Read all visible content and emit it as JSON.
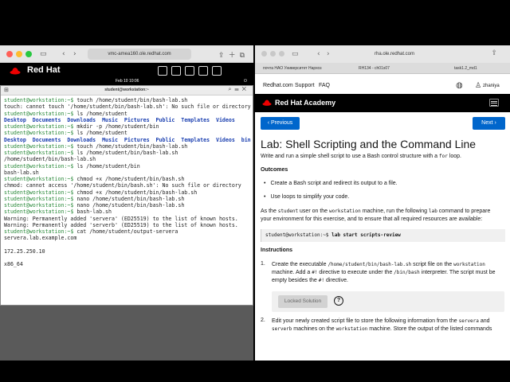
{
  "left_window": {
    "url": "vmc-amea160.ole.redhat.com",
    "tool_icons": {
      "sidebar": "sidebar-icon",
      "back": "‹",
      "forward": "›"
    },
    "brand": "Red Hat",
    "clock": "Feb 10  10:06",
    "terminal_title": "student@workstation:~",
    "terminal_lines": [
      {
        "prompt": "student@workstation:~$",
        "text": " touch /home/student/bin/bash-lab.sh"
      },
      {
        "text": "touch: cannot touch '/home/student/bin/bash-lab.sh': No such file or directory"
      },
      {
        "prompt": "student@workstation:~$",
        "text": " ls /home/student"
      },
      {
        "dirs": "Desktop  Documents  Downloads  Music  Pictures  Public  Templates  Videos"
      },
      {
        "prompt": "student@workstation:~$",
        "text": " mkdir -p /home/student/bin"
      },
      {
        "prompt": "student@workstation:~$",
        "text": " ls /home/student"
      },
      {
        "dirs": "Desktop  Documents  Downloads  Music  Pictures  Public  Templates  Videos  bin"
      },
      {
        "prompt": "student@workstation:~$",
        "text": " touch /home/student/bin/bash-lab.sh"
      },
      {
        "prompt": "student@workstation:~$",
        "text": " ls /home/student/bin/bash-lab.sh"
      },
      {
        "text": "/home/student/bin/bash-lab.sh"
      },
      {
        "prompt": "student@workstation:~$",
        "text": " ls /home/student/bin"
      },
      {
        "text": "bash-lab.sh"
      },
      {
        "prompt": "student@workstation:~$",
        "text": " chmod +x /home/student/bin/bash.sh"
      },
      {
        "text": "chmod: cannot access '/home/student/bin/bash.sh': No such file or directory"
      },
      {
        "prompt": "student@workstation:~$",
        "text": " chmod +x /home/student/bin/bash-lab.sh"
      },
      {
        "prompt": "student@workstation:~$",
        "text": " nano /home/student/bin/bash-lab.sh"
      },
      {
        "prompt": "student@workstation:~$",
        "text": " nano /home/student/bin/bash-lab.sh"
      },
      {
        "prompt": "student@workstation:~$",
        "text": " bash-lab.sh"
      },
      {
        "text": "Warning: Permanently added 'servera' (ED25519) to the list of known hosts."
      },
      {
        "text": "Warning: Permanently added 'serverb' (ED25519) to the list of known hosts."
      },
      {
        "prompt": "student@workstation:~$",
        "text": " cat /home/student/output-servera"
      },
      {
        "text": "servera.lab.example.com"
      },
      {
        "text": ""
      },
      {
        "text": "172.25.250.10"
      },
      {
        "text": ""
      },
      {
        "text": "x86_64"
      }
    ]
  },
  "right_window": {
    "url": "rha.ole.redhat.com",
    "tabs": [
      "почта НАО Университет Нархоз",
      "RH134 - ch01s07",
      "task1.2_md1"
    ],
    "nav": {
      "site": "Redhat.com",
      "support": "Support",
      "faq": "FAQ",
      "user": "zhaniya"
    },
    "academy": "Red Hat Academy",
    "prev_label": "Previous",
    "next_label": "Next",
    "title": "Lab: Shell Scripting and the Command Line",
    "subtitle_pre": "Write and run a simple shell script to use a Bash control structure with a ",
    "subtitle_code": "for",
    "subtitle_post": " loop.",
    "outcomes_heading": "Outcomes",
    "outcomes": [
      "Create a Bash script and redirect its output to a file.",
      "Use loops to simplify your code."
    ],
    "setup": {
      "p1": "As the ",
      "c1": "student",
      "p2": " user on the ",
      "c2": "workstation",
      "p3": " machine, run the following ",
      "c3": "lab",
      "p4": " command to prepare",
      "line2": "your environment for this exercise, and to ensure that all required resources are available:"
    },
    "command": {
      "prompt": "student@workstation:~$ ",
      "cmd": "lab start scripts-review"
    },
    "instructions_heading": "Instructions",
    "step1": {
      "num": "1.",
      "a": "Create the executable ",
      "b": "/home/student/bin/bash-lab.sh",
      "c": " script file on the ",
      "d": "workstation",
      "e": "machine. Add a ",
      "f": "#!",
      "g": " directive to execute under the ",
      "h": "/bin/bash",
      "i": " interpreter. The script must be",
      "j": "empty besides the ",
      "k": "#!",
      "l": " directive."
    },
    "locked_solution": "Locked Solution",
    "step2": {
      "num": "2.",
      "a": "Edit your newly created script file to store the following information from the ",
      "b": "servera",
      " and_text": " and",
      "c": "serverb",
      "d": " machines on the ",
      "e": "workstation",
      "f": " machine. Store the output of the listed commands"
    }
  }
}
